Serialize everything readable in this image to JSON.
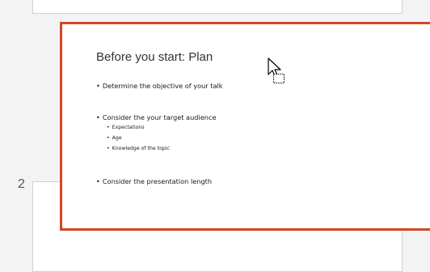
{
  "slide_panel": {
    "next_slide_number": "2"
  },
  "selected_slide": {
    "title": "Before you start: Plan",
    "bullets": [
      {
        "text": "Determine the objective of your talk",
        "level": 1
      },
      {
        "text": "Consider the your target audience",
        "level": 1
      },
      {
        "text": "Expectations",
        "level": 2
      },
      {
        "text": "Age",
        "level": 2
      },
      {
        "text": "Knowledge of the topic",
        "level": 2
      },
      {
        "text": "Consider the presentation length",
        "level": 1
      }
    ]
  },
  "colors": {
    "selection_border": "#d24726",
    "panel_background": "#f3f3f3"
  },
  "icons": {
    "cursor": "move-cursor-icon"
  }
}
